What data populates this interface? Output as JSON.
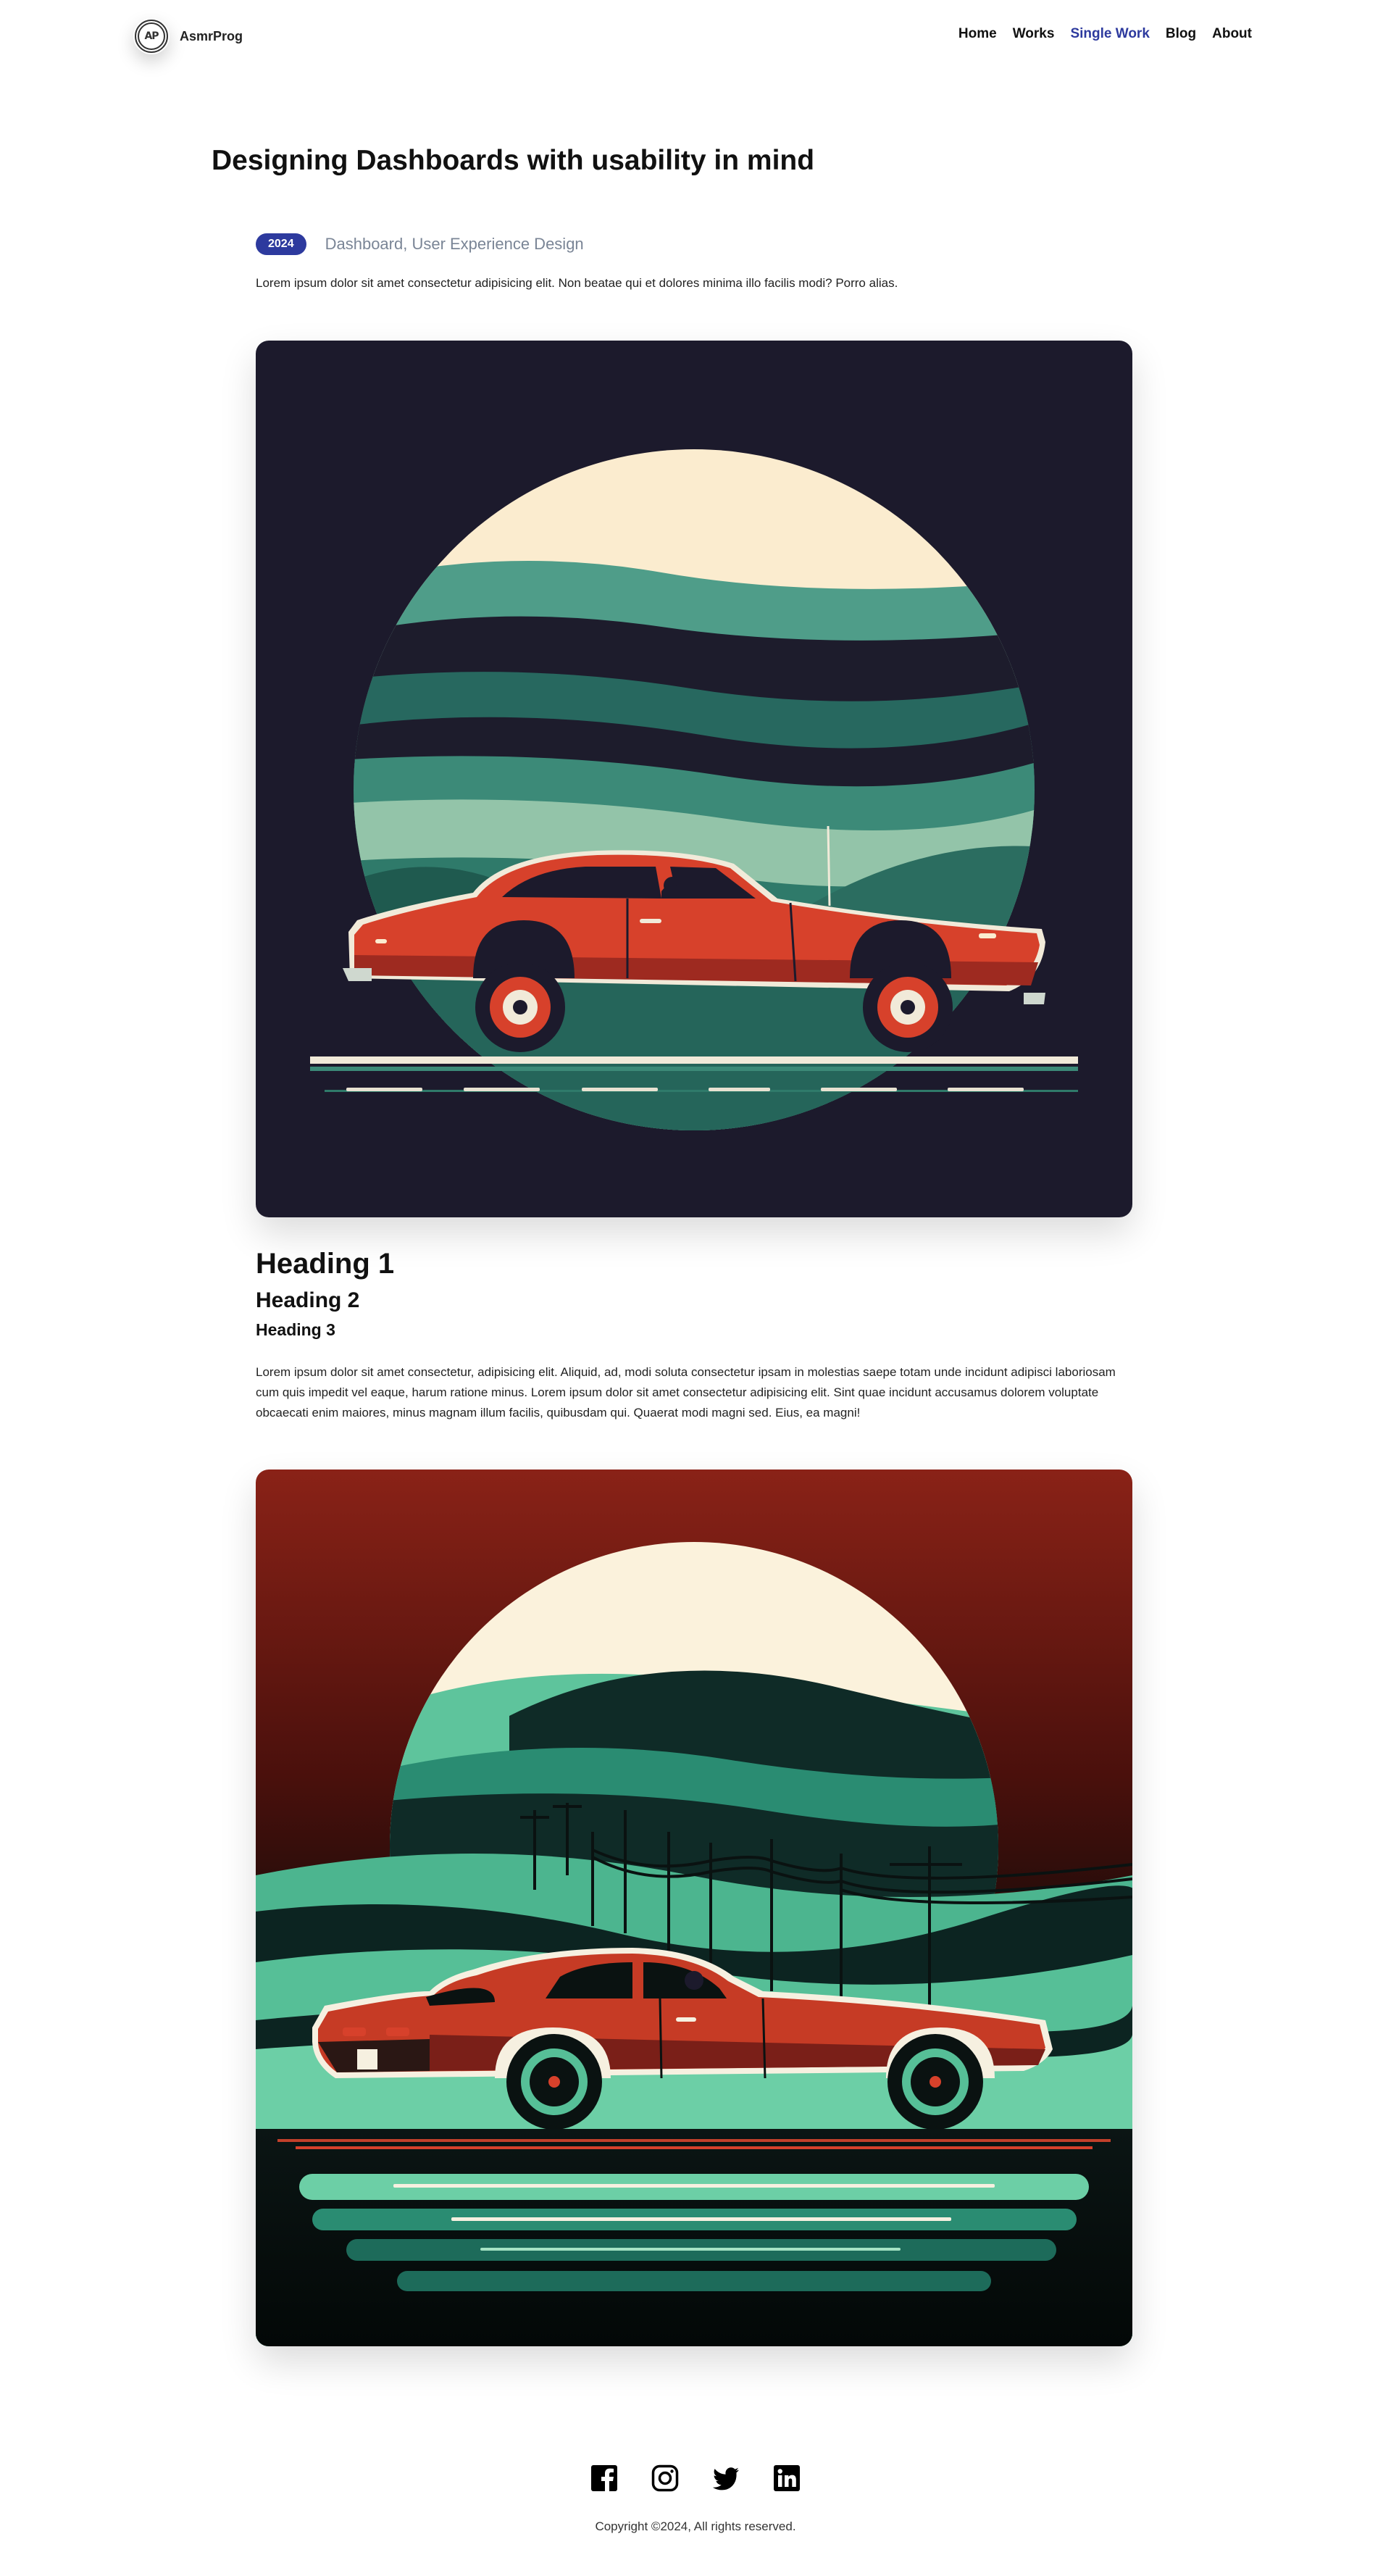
{
  "header": {
    "logo_text": "AP",
    "brand_name": "AsmrProg",
    "nav": [
      {
        "label": "Home"
      },
      {
        "label": "Works"
      },
      {
        "label": "Single Work",
        "active": true
      },
      {
        "label": "Blog"
      },
      {
        "label": "About"
      }
    ],
    "active_color": "#2d3a9e"
  },
  "article": {
    "title": "Designing Dashboards with usability in mind",
    "year": "2024",
    "tags": "Dashboard, User Experience Design",
    "intro": "Lorem ipsum dolor sit amet consectetur adipisicing elit. Non beatae qui et dolores minima illo facilis modi? Porro alias.",
    "heading1": "Heading 1",
    "heading2": "Heading 2",
    "heading3": "Heading 3",
    "body": "Lorem ipsum dolor sit amet consectetur, adipisicing elit. Aliquid, ad, modi soluta consectetur ipsam in molestias saepe totam unde incidunt adipisci laboriosam cum quis impedit vel eaque, harum ratione minus. Lorem ipsum dolor sit amet consectetur adipisicing elit. Sint quae incidunt accusamus dolorem voluptate obcaecati enim maiores, minus magnam illum facilis, quibusdam qui. Quaerat modi magni sed. Eius, ea magni!",
    "images": [
      {
        "subject": "red classic car illustration, dark background with teal hills and cream sun"
      },
      {
        "subject": "red classic car illustration, red sky with green hills and power lines"
      }
    ]
  },
  "footer": {
    "social_icons": [
      "facebook-icon",
      "instagram-icon",
      "twitter-icon",
      "linkedin-icon"
    ],
    "copyright": "Copyright ©2024, All rights reserved."
  }
}
